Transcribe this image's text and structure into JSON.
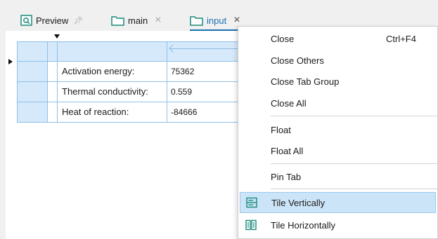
{
  "tabs": [
    {
      "label": "Preview",
      "pin": "pin-icon"
    },
    {
      "label": "main",
      "close": "close-icon"
    },
    {
      "label": "input",
      "close": "close-icon",
      "active": true
    }
  ],
  "table": {
    "rows": [
      {
        "label": "Activation energy:",
        "value": "75362"
      },
      {
        "label": "Thermal conductivity:",
        "value": "0.559"
      },
      {
        "label": "Heat of reaction:",
        "value": "-84666"
      }
    ]
  },
  "context_menu": {
    "items": [
      {
        "label": "Close",
        "shortcut": "Ctrl+F4"
      },
      {
        "label": "Close Others"
      },
      {
        "label": "Close Tab Group"
      },
      {
        "label": "Close All"
      },
      {
        "label": "Float"
      },
      {
        "label": "Float All"
      },
      {
        "label": "Pin Tab"
      },
      {
        "label": "Tile Vertically",
        "icon": "tile-vertically-icon",
        "highlighted": true
      },
      {
        "label": "Tile Horizontally",
        "icon": "tile-horizontally-icon"
      }
    ]
  },
  "colors": {
    "accent": "#1a6fb5",
    "grid_header": "#d6e9fa",
    "highlight": "#cce4f7",
    "icon_teal": "#1a8a7a"
  }
}
